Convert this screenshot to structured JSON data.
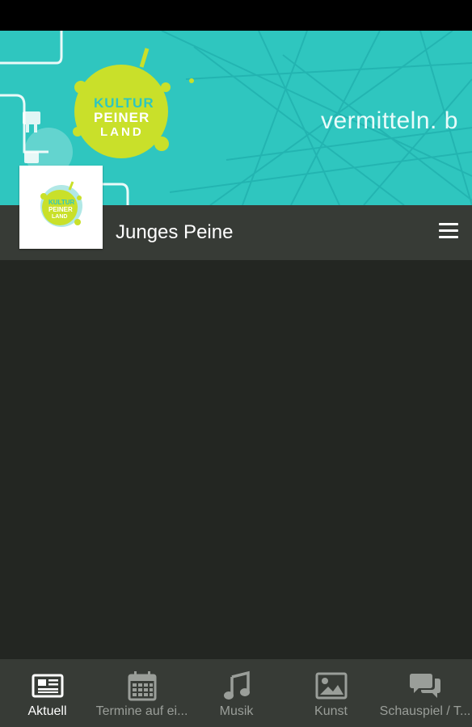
{
  "banner": {
    "tagline": "vermitteln. b",
    "logo_text": "KULTUR PEINER LAND"
  },
  "header": {
    "title": "Junges Peine"
  },
  "tabs": [
    {
      "label": "Aktuell",
      "icon": "newspaper-icon",
      "active": true
    },
    {
      "label": "Termine auf ei...",
      "icon": "calendar-icon",
      "active": false
    },
    {
      "label": "Musik",
      "icon": "music-note-icon",
      "active": false
    },
    {
      "label": "Kunst",
      "icon": "image-icon",
      "active": false
    },
    {
      "label": "Schauspiel / T...",
      "icon": "chat-bubbles-icon",
      "active": false
    }
  ],
  "colors": {
    "banner": "#2fc6bf",
    "logo": "#c9e02a",
    "bar": "#373b36",
    "background": "#232622"
  }
}
